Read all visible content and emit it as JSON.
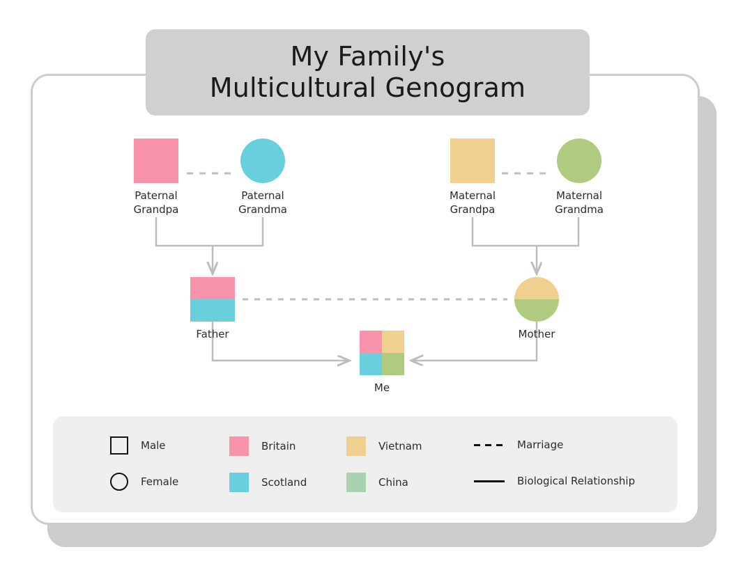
{
  "title": {
    "line1": "My Family's",
    "line2": "Multicultural Genogram"
  },
  "colors": {
    "britain": "#F794AC",
    "scotland": "#6ACFDC",
    "vietnam": "#EFD08E",
    "china": "#AECB80",
    "china_legend": "#A9D2B0",
    "connector": "#bdbdbd",
    "card_border": "#cccccc",
    "card_shadow": "#cccccc",
    "banner_bg": "#d0d0d0",
    "legend_bg": "#efefef",
    "outline": "#111111",
    "text": "#2b2b2b"
  },
  "people": [
    {
      "id": "paternal-grandpa",
      "label": "Paternal\nGrandpa",
      "gender": "male",
      "shape": "square",
      "fills": [
        "britain"
      ]
    },
    {
      "id": "paternal-grandma",
      "label": "Paternal\nGrandma",
      "gender": "female",
      "shape": "circle",
      "fills": [
        "scotland"
      ]
    },
    {
      "id": "maternal-grandpa",
      "label": "Maternal\nGrandpa",
      "gender": "male",
      "shape": "square",
      "fills": [
        "vietnam"
      ]
    },
    {
      "id": "maternal-grandma",
      "label": "Maternal\nGrandma",
      "gender": "female",
      "shape": "circle",
      "fills": [
        "china"
      ]
    },
    {
      "id": "father",
      "label": "Father",
      "gender": "male",
      "shape": "square",
      "fills": [
        "britain",
        "scotland"
      ]
    },
    {
      "id": "mother",
      "label": "Mother",
      "gender": "female",
      "shape": "circle",
      "fills": [
        "vietnam",
        "china"
      ]
    },
    {
      "id": "me",
      "label": "Me",
      "gender": "male",
      "shape": "square",
      "fills": [
        "britain",
        "vietnam",
        "scotland",
        "china"
      ]
    }
  ],
  "legend": {
    "symbols": [
      {
        "label": "Male",
        "icon": "outline-square"
      },
      {
        "label": "Female",
        "icon": "outline-circle"
      }
    ],
    "heritage": [
      {
        "label": "Britain",
        "color": "#F794AC"
      },
      {
        "label": "Scotland",
        "color": "#6ACFDC"
      },
      {
        "label": "Vietnam",
        "color": "#EFD08E"
      },
      {
        "label": "China",
        "color": "#A9D2B0"
      }
    ],
    "lines": [
      {
        "label": "Marriage",
        "style": "dashed"
      },
      {
        "label": "Biological Relationship",
        "style": "solid"
      }
    ]
  }
}
